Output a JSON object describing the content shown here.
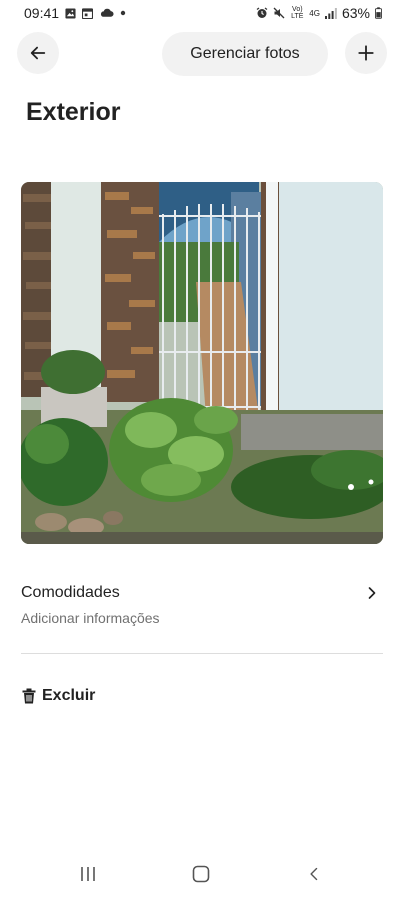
{
  "status_bar": {
    "time": "09:41",
    "battery": "63%",
    "network_label": "4G",
    "volte_label": "Vo) LTE",
    "icons": [
      "image-icon",
      "calendar-icon",
      "cloud-icon",
      "dot-icon",
      "alarm-icon",
      "mute-icon",
      "volte-icon",
      "4g-icon",
      "signal-icon",
      "battery-icon"
    ]
  },
  "header": {
    "back_icon": "arrow-left-icon",
    "manage_label": "Gerenciar fotos",
    "add_icon": "plus-icon"
  },
  "page": {
    "title": "Exterior"
  },
  "photo": {
    "subject": "outdoor-gate-photo"
  },
  "amenities": {
    "title": "Comodidades",
    "subtitle": "Adicionar informações",
    "chevron_icon": "chevron-right-icon"
  },
  "actions": {
    "delete_label": "Excluir",
    "delete_icon": "trash-icon"
  },
  "nav_bar": {
    "icons": [
      "recent-apps-icon",
      "home-icon",
      "back-icon"
    ]
  },
  "colors": {
    "background": "#ffffff",
    "button_bg": "#f2f2f2",
    "text_primary": "#222222",
    "text_secondary": "#717171",
    "divider": "#dddddd"
  }
}
